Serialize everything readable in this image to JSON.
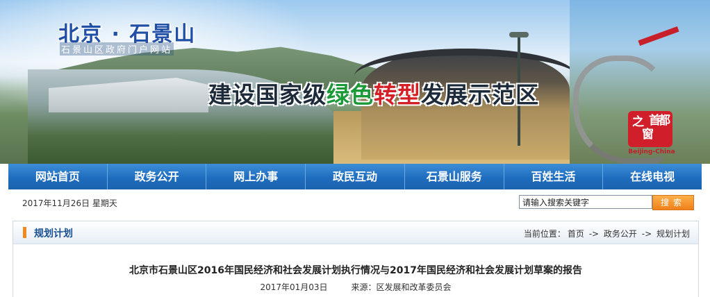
{
  "header": {
    "site_title": "北京 · 石景山",
    "site_subtitle": "石景山区政府门户网站",
    "slogan_part1": "建设国家级",
    "slogan_green": "绿色",
    "slogan_red": "转型",
    "slogan_part2": "发展示范区",
    "seal_chars": [
      "首",
      "都",
      "之",
      "窗"
    ],
    "seal_caption": "Beijing-China"
  },
  "nav": {
    "items": [
      {
        "label": "网站首页"
      },
      {
        "label": "政务公开"
      },
      {
        "label": "网上办事"
      },
      {
        "label": "政民互动"
      },
      {
        "label": "石景山服务"
      },
      {
        "label": "百姓生活"
      },
      {
        "label": "在线电视"
      }
    ]
  },
  "infobar": {
    "date": "2017年11月26日  星期天",
    "search_value": "请输入搜索关键字",
    "search_button": "搜索"
  },
  "section": {
    "title": "规划计划",
    "breadcrumb_label": "当前位置：",
    "breadcrumb": [
      "首页",
      "政务公开",
      "规划计划"
    ],
    "separator": "->"
  },
  "article": {
    "title": "北京市石景山区2016年国民经济和社会发展计划执行情况与2017年国民经济和社会发展计划草案的报告",
    "date": "2017年01月03日",
    "source": "来源：区发展和改革委员会"
  },
  "colors": {
    "nav_bg": "#1f6dbf",
    "accent_orange": "#f08a1c",
    "title_blue": "#1f4fa6",
    "slogan_green": "#1a9a36",
    "slogan_red": "#d41f26"
  }
}
